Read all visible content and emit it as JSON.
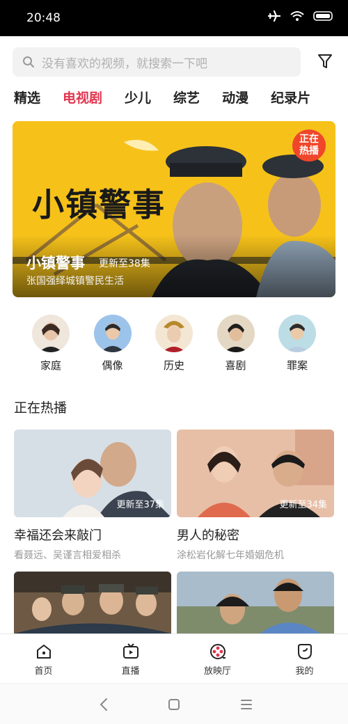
{
  "status": {
    "time": "20:48"
  },
  "search": {
    "placeholder": "没有喜欢的视频，就搜索一下吧"
  },
  "tabs": [
    "精选",
    "电视剧",
    "少儿",
    "综艺",
    "动漫",
    "纪录片"
  ],
  "active_tab": "电视剧",
  "banner": {
    "big_title": "小镇警事",
    "title": "小镇警事",
    "update": "更新至38集",
    "subtitle": "张国强绎城镇警民生活",
    "hot_badge_line1": "正在",
    "hot_badge_line2": "热播"
  },
  "categories": [
    {
      "label": "家庭"
    },
    {
      "label": "偶像"
    },
    {
      "label": "历史"
    },
    {
      "label": "喜剧"
    },
    {
      "label": "罪案"
    }
  ],
  "section_title": "正在热播",
  "cards": [
    {
      "name": "幸福还会来敲门",
      "desc": "看聂远、吴谨言相爱相杀",
      "episode": "更新至37集"
    },
    {
      "name": "男人的秘密",
      "desc": "涂松岩化解七年婚姻危机",
      "episode": "更新至34集"
    }
  ],
  "bottom_nav": [
    {
      "label": "首页",
      "icon": "home-icon"
    },
    {
      "label": "直播",
      "icon": "tv-icon"
    },
    {
      "label": "放映厅",
      "icon": "film-reel-icon"
    },
    {
      "label": "我的",
      "icon": "profile-icon"
    }
  ]
}
